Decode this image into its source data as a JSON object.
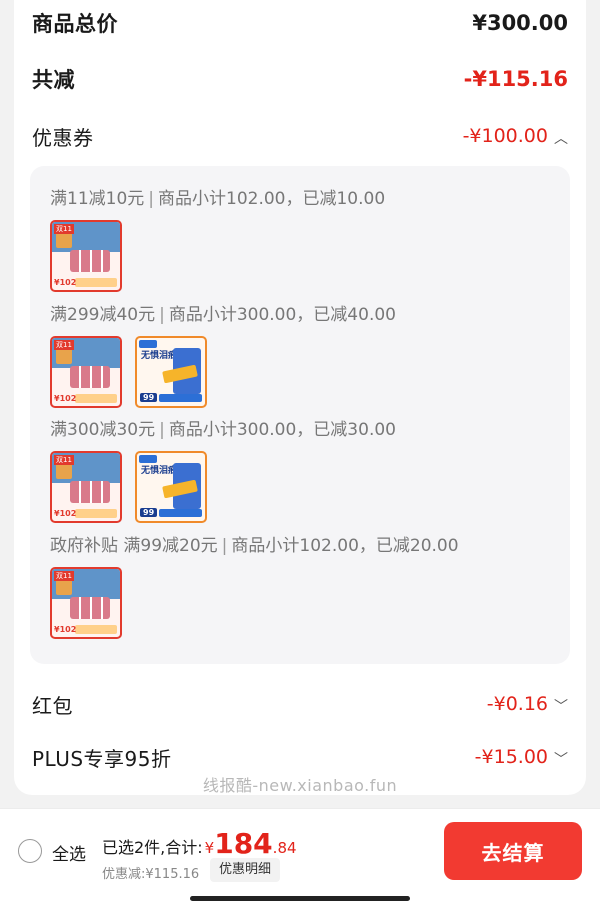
{
  "summary": {
    "total_label": "商品总价",
    "total_value": "¥300.00",
    "reduce_label": "共减",
    "reduce_value": "-¥115.16",
    "coupon_label": "优惠券",
    "coupon_value": "-¥100.00"
  },
  "discounts": [
    {
      "rule": "满11减10元",
      "detail": "商品小计102.00，已减10.00"
    },
    {
      "rule": "满299减40元",
      "detail": "商品小计300.00，已减40.00"
    },
    {
      "rule": "满300减30元",
      "detail": "商品小计300.00，已减30.00"
    },
    {
      "rule": "政府补贴 满99减20元",
      "detail": "商品小计102.00，已减20.00"
    }
  ],
  "products": {
    "can_food": {
      "badge": "双11",
      "price": "¥102",
      "colors": {
        "frame": "#e23a2d",
        "band": "#5f94c9"
      }
    },
    "dry_food": {
      "title": "无惧泪痕",
      "count": "99",
      "colors": {
        "frame": "#f08a2a",
        "bag": "#3b6fd1"
      }
    }
  },
  "extras": {
    "hongbao_label": "红包",
    "hongbao_value": "-¥0.16",
    "plus_label": "PLUS专享95折",
    "plus_value": "-¥15.00"
  },
  "watermark": "线报酷-new.xianbao.fun",
  "footer": {
    "select_all": "全选",
    "selected_text": "已选2件,合计:",
    "currency": "¥",
    "total_int": "184",
    "total_dec": ".84",
    "saved_text": "优惠减:¥115.16",
    "detail_button": "优惠明细",
    "checkout_button": "去结算"
  },
  "colors": {
    "accent_red": "#e2231a",
    "checkout_bg": "#f23a31"
  }
}
